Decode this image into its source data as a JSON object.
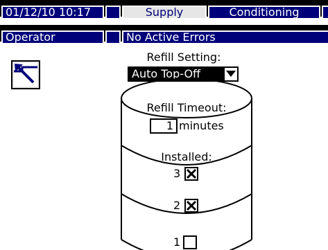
{
  "header": {
    "datetime": "01/12/10 10:17",
    "tabs": [
      {
        "label": "Supply"
      },
      {
        "label": "Conditioning"
      }
    ],
    "user_role": "Operator",
    "status_message": "No Active Errors"
  },
  "screen": {
    "exit_icon": "exit-screen-icon",
    "refill_setting_label": "Refill Setting:",
    "refill_setting_value": "Auto Top-Off",
    "refill_timeout_label": "Refill Timeout:",
    "refill_timeout_value": "1",
    "refill_timeout_unit": "minutes",
    "installed_label": "Installed:",
    "levels": [
      {
        "number": "3",
        "checked": true
      },
      {
        "number": "2",
        "checked": true
      },
      {
        "number": "1",
        "checked": false
      }
    ]
  },
  "colors": {
    "navy": "#00007a",
    "active_tab": "#e6e6e6",
    "black": "#000000"
  }
}
